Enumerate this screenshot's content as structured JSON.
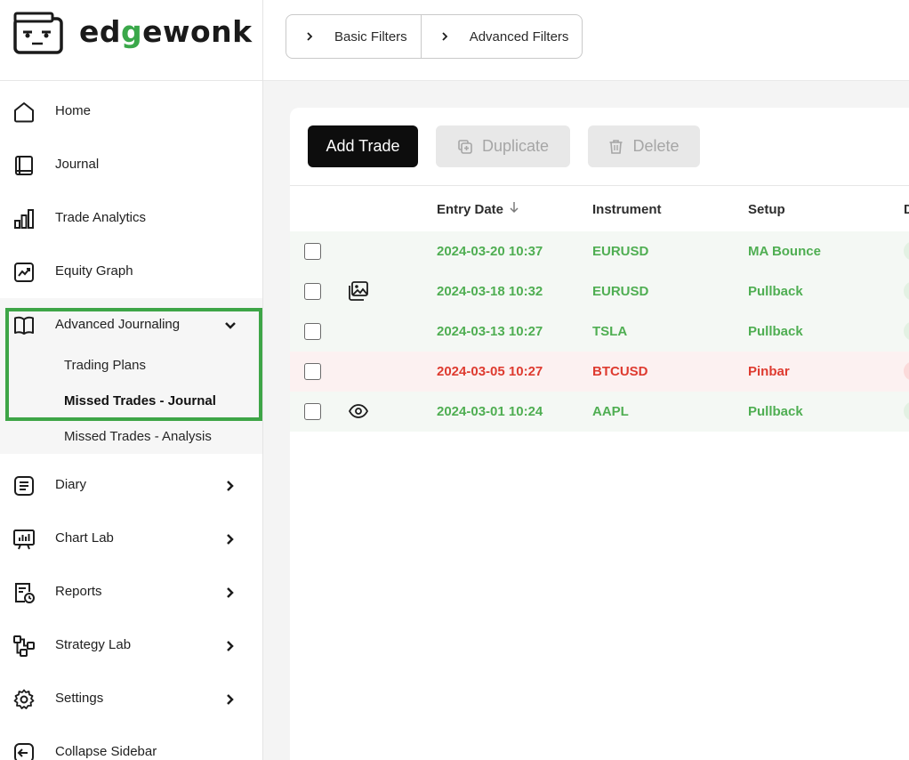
{
  "brand": {
    "name_pre": "ed",
    "name_g": "g",
    "name_post": "ewonk"
  },
  "sidebar": {
    "items": [
      {
        "label": "Home",
        "icon": "home-icon"
      },
      {
        "label": "Journal",
        "icon": "book-icon"
      },
      {
        "label": "Trade Analytics",
        "icon": "bar-chart-icon"
      },
      {
        "label": "Equity Graph",
        "icon": "trend-chart-icon"
      },
      {
        "label": "Advanced Journaling",
        "icon": "open-book-icon",
        "expanded": true
      },
      {
        "label": "Diary",
        "icon": "document-lines-icon"
      },
      {
        "label": "Chart Lab",
        "icon": "presentation-chart-icon"
      },
      {
        "label": "Reports",
        "icon": "report-clock-icon"
      },
      {
        "label": "Strategy Lab",
        "icon": "flow-diagram-icon"
      },
      {
        "label": "Settings",
        "icon": "gear-icon"
      },
      {
        "label": "Collapse Sidebar",
        "icon": "collapse-icon"
      }
    ],
    "sub_items": [
      {
        "label": "Trading Plans",
        "active": false
      },
      {
        "label": "Missed Trades - Journal",
        "active": true
      },
      {
        "label": "Missed Trades - Analysis",
        "active": false
      }
    ]
  },
  "filters": {
    "basic": "Basic Filters",
    "advanced": "Advanced Filters"
  },
  "toolbar": {
    "add": "Add Trade",
    "duplicate": "Duplicate",
    "delete": "Delete"
  },
  "table": {
    "columns": [
      "Entry Date",
      "Instrument",
      "Setup",
      "D"
    ],
    "rows": [
      {
        "date": "2024-03-20 10:37",
        "instrument": "EURUSD",
        "setup": "MA Bounce",
        "status": "win",
        "icon": ""
      },
      {
        "date": "2024-03-18 10:32",
        "instrument": "EURUSD",
        "setup": "Pullback",
        "status": "win",
        "icon": "image-gallery-icon"
      },
      {
        "date": "2024-03-13 10:27",
        "instrument": "TSLA",
        "setup": "Pullback",
        "status": "win",
        "icon": ""
      },
      {
        "date": "2024-03-05 10:27",
        "instrument": "BTCUSD",
        "setup": "Pinbar",
        "status": "loss",
        "icon": ""
      },
      {
        "date": "2024-03-01 10:24",
        "instrument": "AAPL",
        "setup": "Pullback",
        "status": "win",
        "icon": "eye-icon"
      }
    ]
  },
  "colors": {
    "accent_green": "#3ea547",
    "win_text": "#4fae52",
    "loss_text": "#de3b30",
    "primary_button": "#0d0d0d"
  }
}
